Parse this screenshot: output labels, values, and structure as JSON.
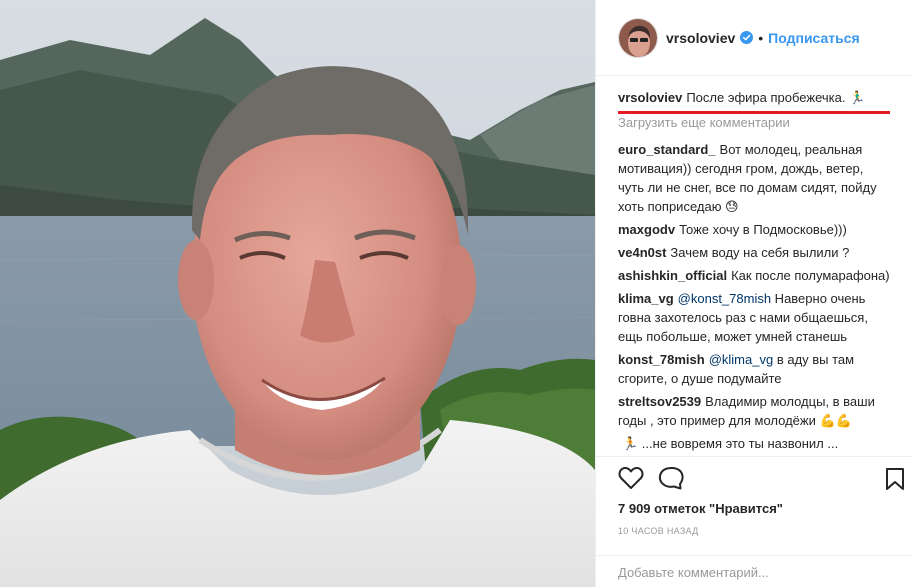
{
  "header": {
    "username": "vrsoloviev",
    "separator": "•",
    "follow_label": "Подписаться"
  },
  "caption": {
    "username": "vrsoloviev",
    "text": "После эфира пробежечка. 🏃‍♂️"
  },
  "load_more_label": "Загрузить еще комментарии",
  "comments": [
    {
      "user": "euro_standard_",
      "text": "Вот молодец, реальная мотивация)) сегодня гром, дождь, ветер, чуть ли не снег, все по домам сидят, пойду хоть поприседаю 😓"
    },
    {
      "user": "maxgodv",
      "text": "Тоже хочу в Подмосковье)))"
    },
    {
      "user": "ve4n0st",
      "text": "Зачем воду на себя вылили ?"
    },
    {
      "user": "ashishkin_official",
      "text": "Как после полумарафона)"
    },
    {
      "user": "klima_vg",
      "mention": "@konst_78mish",
      "text": " Наверно очень говна захотелось раз с нами общаешься, ещь побольше, может умней станешь"
    },
    {
      "user": "konst_78mish",
      "mention": "@klima_vg",
      "text": " в аду вы там сгорите, о душе подумайте"
    },
    {
      "user": "streltsov2539",
      "text": "Владимир молодцы, в ваши годы , это пример для молодёжи 💪💪"
    },
    {
      "user": "",
      "text": "🏃 ...не вовремя это ты назвонил ..."
    }
  ],
  "likes_label": "7 909 отметок \"Нравится\"",
  "time_label": "10 ЧАСОВ НАЗАД",
  "add_comment_placeholder": "Добавьте комментарий...",
  "colors": {
    "accent": "#3897f0",
    "annotation": "#e31b23"
  },
  "icons": [
    "verified-badge-icon",
    "heart-icon",
    "comment-icon",
    "bookmark-icon"
  ]
}
